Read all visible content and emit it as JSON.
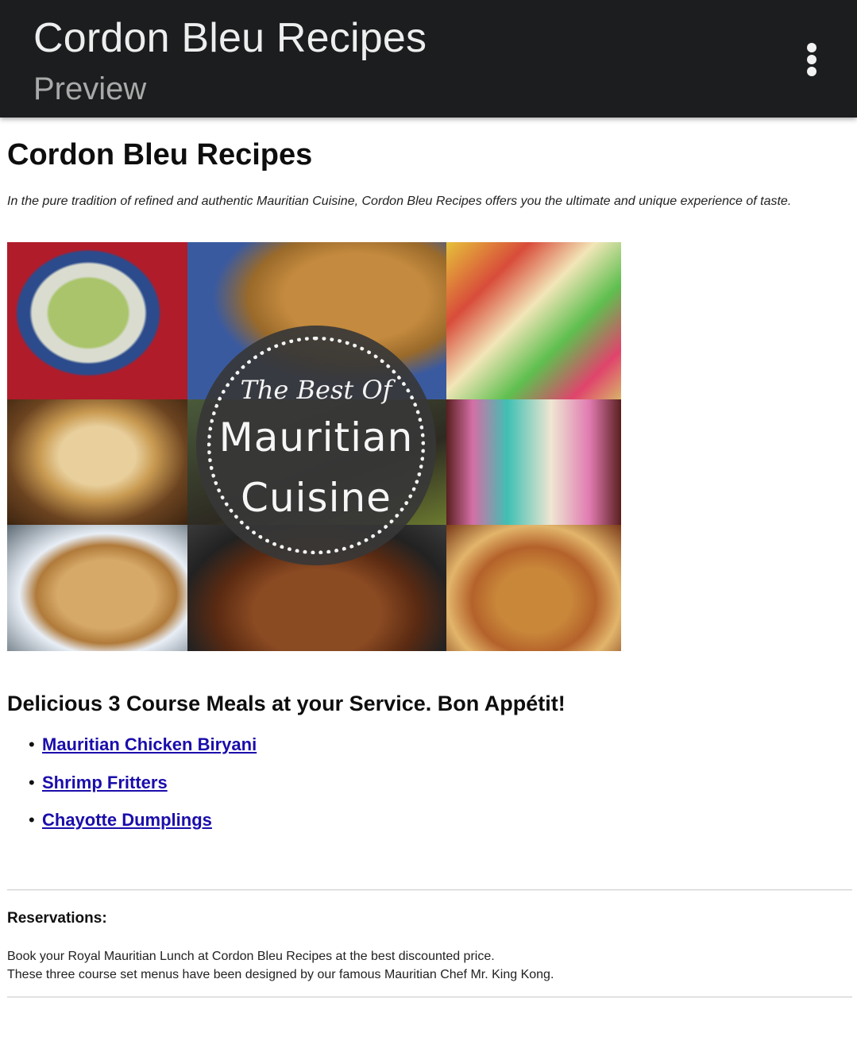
{
  "appbar": {
    "title": "Cordon Bleu Recipes",
    "subtitle": "Preview",
    "menu_icon": "more-vert-icon",
    "background": "#1b1d1f"
  },
  "page": {
    "heading": "Cordon Bleu Recipes",
    "intro": "In the pure tradition of refined and authentic Mauritian Cuisine, Cordon Bleu Recipes offers you the ultimate and unique experience of taste."
  },
  "banner": {
    "badge_line1": "The Best Of",
    "badge_line2": "Mauritian",
    "badge_line3": "Cuisine"
  },
  "meals": {
    "heading": "Delicious 3 Course Meals at your Service. Bon Appétit!",
    "items": [
      {
        "label": "Mauritian Chicken Biryani"
      },
      {
        "label": "Shrimp Fritters"
      },
      {
        "label": "Chayotte Dumplings"
      }
    ],
    "bullet": "•",
    "link_color": "#1a0dab"
  },
  "reservations": {
    "heading": "Reservations:",
    "line1": "Book your Royal Mauritian Lunch at Cordon Bleu Recipes at the best discounted price.",
    "line2": "These three course set menus have been designed by our famous Mauritian Chef Mr. King Kong."
  }
}
